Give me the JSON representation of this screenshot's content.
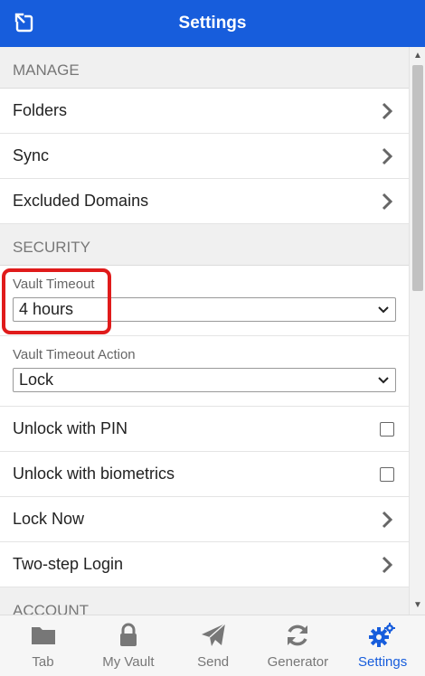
{
  "header": {
    "title": "Settings",
    "popout_icon": "popout-icon"
  },
  "sections": {
    "manage": {
      "title": "Manage",
      "items": [
        {
          "label": "Folders"
        },
        {
          "label": "Sync"
        },
        {
          "label": "Excluded Domains"
        }
      ]
    },
    "security": {
      "title": "Security",
      "vault_timeout": {
        "label": "Vault Timeout",
        "value": "4 hours"
      },
      "vault_timeout_action": {
        "label": "Vault Timeout Action",
        "value": "Lock"
      },
      "unlock_pin": {
        "label": "Unlock with PIN",
        "checked": false
      },
      "unlock_biometrics": {
        "label": "Unlock with biometrics",
        "checked": false
      },
      "lock_now": {
        "label": "Lock Now"
      },
      "two_step": {
        "label": "Two-step Login"
      }
    },
    "account": {
      "title": "Account"
    }
  },
  "tabs": [
    {
      "label": "Tab",
      "icon": "folder-icon"
    },
    {
      "label": "My Vault",
      "icon": "lock-icon"
    },
    {
      "label": "Send",
      "icon": "paper-plane-icon"
    },
    {
      "label": "Generator",
      "icon": "refresh-icon"
    },
    {
      "label": "Settings",
      "icon": "gears-icon",
      "active": true
    }
  ],
  "colors": {
    "brand": "#175ddc",
    "highlight": "#e01b1b"
  }
}
